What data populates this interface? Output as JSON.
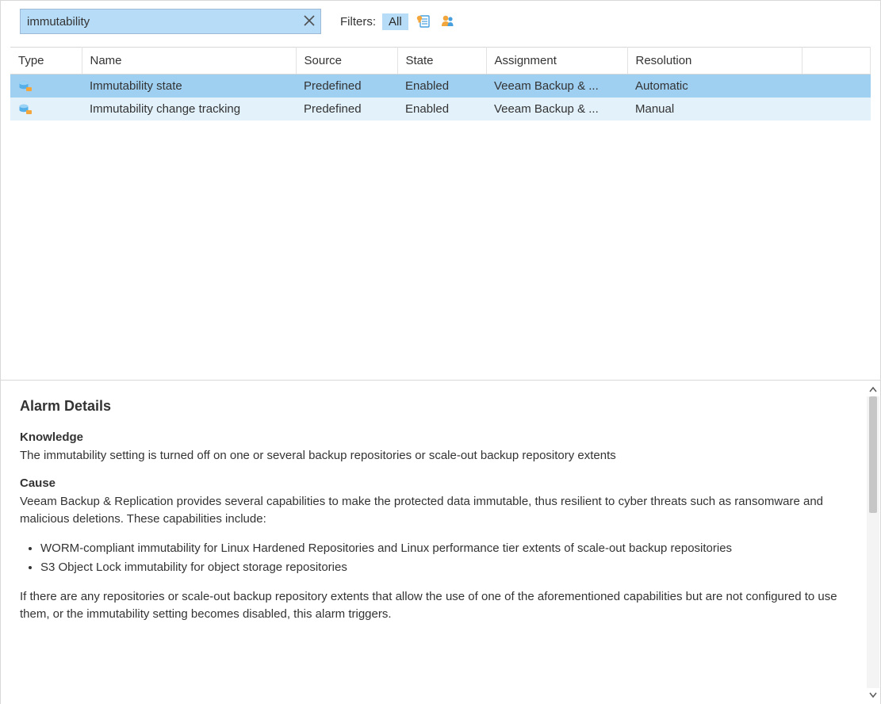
{
  "toolbar": {
    "search_value": "immutability",
    "filters_label": "Filters:",
    "filter_all_label": "All"
  },
  "table": {
    "columns": {
      "type": "Type",
      "name": "Name",
      "source": "Source",
      "state": "State",
      "assignment": "Assignment",
      "resolution": "Resolution"
    },
    "rows": [
      {
        "type_icon": "repository-icon",
        "name": "Immutability state",
        "source": "Predefined",
        "state": "Enabled",
        "assignment": "Veeam Backup & ...",
        "resolution": "Automatic",
        "selected": true
      },
      {
        "type_icon": "repository-icon",
        "name": "Immutability change tracking",
        "source": "Predefined",
        "state": "Enabled",
        "assignment": "Veeam Backup & ...",
        "resolution": "Manual",
        "selected": false
      }
    ]
  },
  "details": {
    "title": "Alarm Details",
    "knowledge_heading": "Knowledge",
    "knowledge_text": "The immutability setting is turned off on one or several backup repositories or scale-out backup repository extents",
    "cause_heading": "Cause",
    "cause_intro": "Veeam Backup & Replication provides several capabilities to make the protected data immutable, thus resilient to cyber threats such as ransomware and malicious deletions. These capabilities include:",
    "cause_bullets": [
      "WORM-compliant immutability for Linux Hardened Repositories and Linux performance tier extents of scale-out backup repositories",
      "S3 Object Lock immutability for object storage repositories"
    ],
    "cause_outro": "If there are any repositories or scale-out backup repository extents that allow the use of one of the aforementioned capabilities but are not configured to use them, or the immutability setting becomes disabled, this alarm triggers."
  }
}
